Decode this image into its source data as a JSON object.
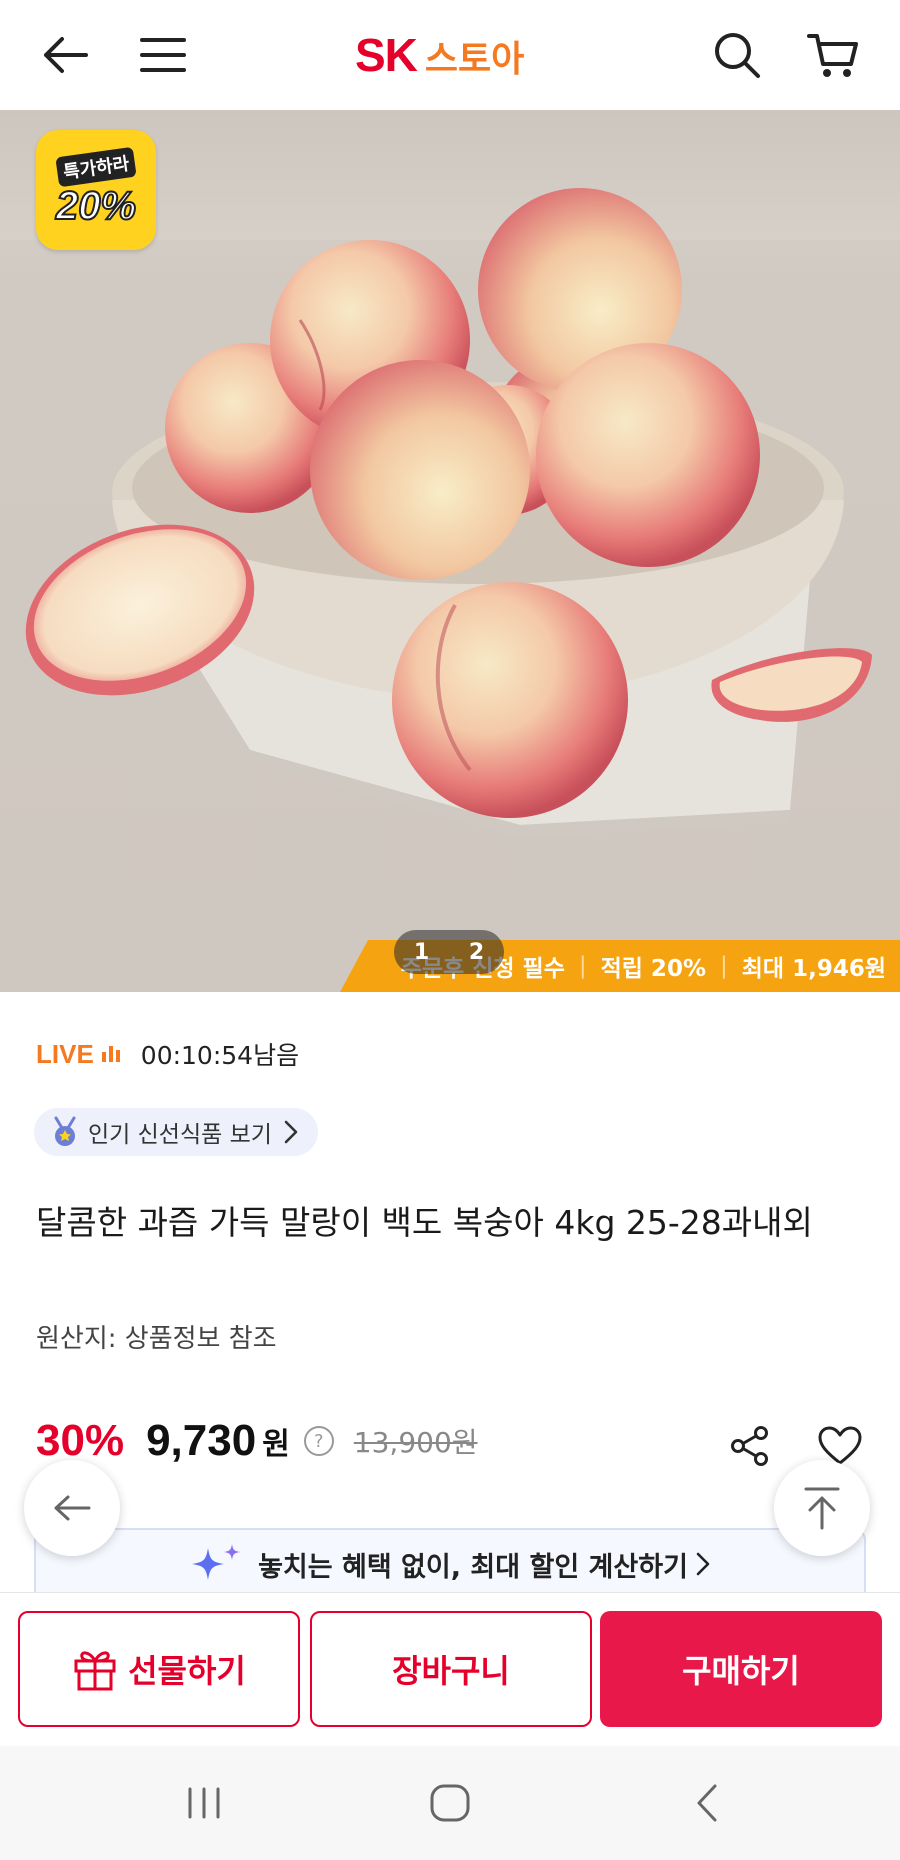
{
  "header": {
    "logo_sk": "SK",
    "logo_store": "스토아",
    "icons": [
      "back-arrow-icon",
      "hamburger-menu-icon",
      "search-icon",
      "cart-icon"
    ]
  },
  "hero": {
    "badge_top": "특가하라",
    "badge_pct": "20%",
    "pager": {
      "current": "1",
      "total": "2"
    },
    "promo": {
      "item1": "주문후 신청 필수",
      "item2": "적립 20%",
      "item3": "최대 1,946원"
    }
  },
  "live": {
    "label": "LIVE",
    "timer": "00:10:54남음"
  },
  "chip": {
    "label": "인기 신선식품 보기",
    "icon": "medal-icon"
  },
  "product": {
    "title": "달콤한 과즙 가득 말랑이 백도 복숭아 4kg 25-28과내외",
    "origin": "원산지: 상품정보 참조",
    "discount": "30%",
    "price": "9,730",
    "currency": "원",
    "help": "?",
    "original_price": "13,900원"
  },
  "benefit": {
    "text": "놓치는 혜택 없이, 최대 할인 계산하기",
    "icon": "sparkle-icon"
  },
  "actions": {
    "gift": "선물하기",
    "cart": "장바구니",
    "buy": "구매하기"
  },
  "colors": {
    "brand_red": "#e4002b",
    "brand_orange": "#f47920",
    "buy_button": "#e8194a",
    "promo_strip": "#f5a310"
  }
}
